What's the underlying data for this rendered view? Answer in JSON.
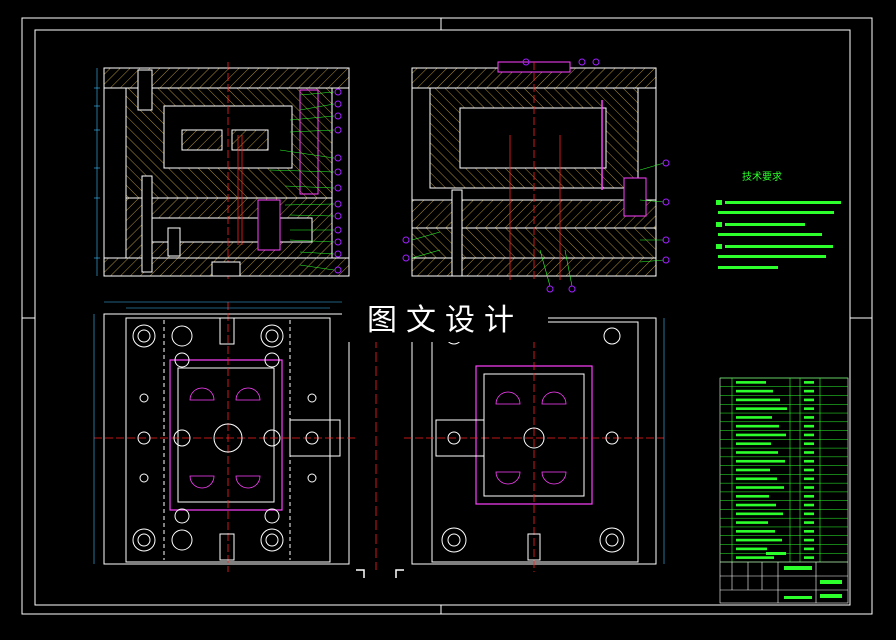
{
  "watermark": "图文设计",
  "notes": {
    "title": "技术要求"
  },
  "colors": {
    "background": "#000000",
    "frame": "#ffffff",
    "hatch": "#d9b24a",
    "centerline": "#ff2020",
    "leader": "#2cff2c",
    "balloon": "#a020ff",
    "part": "#ff40ff",
    "dimension": "#40c0ff"
  },
  "views": [
    "front-section",
    "side-section",
    "moving-half-plan",
    "fixed-half-plan"
  ],
  "bom": {
    "rows": 21
  }
}
